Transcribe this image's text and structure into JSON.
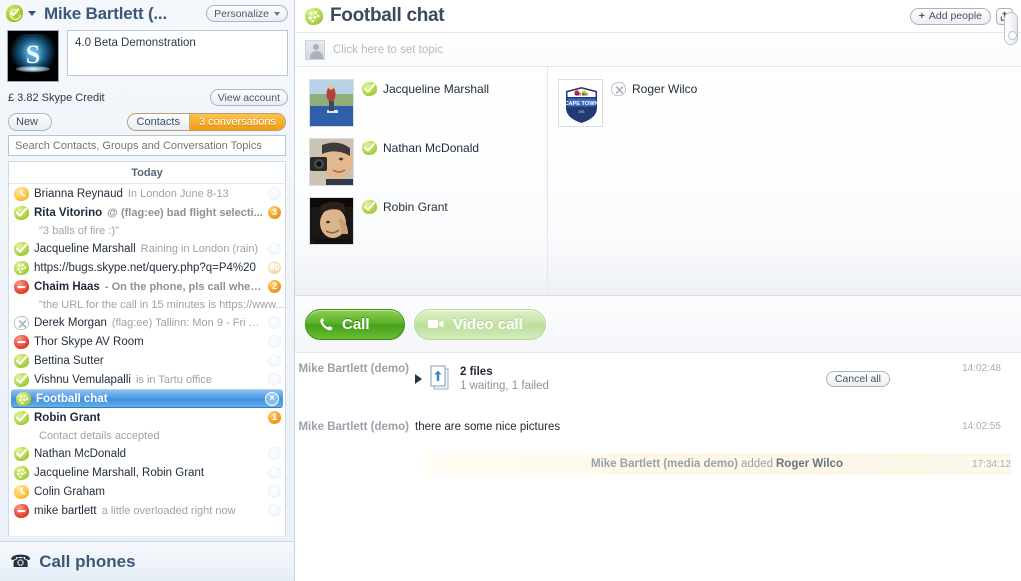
{
  "account": {
    "status_icon": "online-check-icon",
    "name": "Mike Bartlett (...",
    "personalize_label": "Personalize",
    "avatar_letter": "S",
    "mood_message": "4.0 Beta Demonstration",
    "credit": "£ 3.82 Skype Credit",
    "view_account_label": "View account"
  },
  "toolbar": {
    "new_label": "New",
    "tab_contacts": "Contacts",
    "tab_conversations": "3 conversations",
    "search_placeholder": "Search Contacts, Groups and Conversation Topics"
  },
  "list": {
    "day_separator": "Today",
    "rows": [
      {
        "status": "away",
        "name": "Brianna Reynaud",
        "name_bold": false,
        "mood": "In London June 8-13",
        "mood_bold": false,
        "badge": "",
        "badge_style": "ghost",
        "sub": ""
      },
      {
        "status": "online",
        "name": "Rita Vitorino",
        "name_bold": true,
        "mood": "@ (flag:ee) bad flight selecti...",
        "mood_bold": true,
        "badge": "3",
        "badge_style": "solid",
        "sub": "\"3 balls of fire :)\""
      },
      {
        "status": "online",
        "name": "Jacqueline Marshall",
        "name_bold": false,
        "mood": "Raining in London (rain)",
        "mood_bold": false,
        "badge": "",
        "badge_style": "ghost",
        "sub": ""
      },
      {
        "status": "group",
        "name": "https://bugs.skype.net/query.php?q=P4%20",
        "name_bold": false,
        "mood": "",
        "mood_bold": false,
        "badge": "80",
        "badge_style": "dim",
        "sub": ""
      },
      {
        "status": "dnd",
        "name": "Chaim Haas",
        "name_bold": true,
        "mood": "- On the phone, pls call when...",
        "mood_bold": true,
        "badge": "2",
        "badge_style": "solid",
        "sub": "\"the URL for the call in 15 minutes is https://www....\""
      },
      {
        "status": "offline",
        "name": "Derek Morgan",
        "name_bold": false,
        "mood": "(flag:ee) Tallinn: Mon 9 - Fri 13 J...",
        "mood_bold": false,
        "badge": "",
        "badge_style": "ghost",
        "sub": ""
      },
      {
        "status": "dnd",
        "name": "Thor Skype AV Room",
        "name_bold": false,
        "mood": "",
        "mood_bold": false,
        "badge": "",
        "badge_style": "ghost",
        "sub": ""
      },
      {
        "status": "online",
        "name": "Bettina Sutter",
        "name_bold": false,
        "mood": "",
        "mood_bold": false,
        "badge": "",
        "badge_style": "ghost",
        "sub": ""
      },
      {
        "status": "online",
        "name": "Vishnu Vemulapalli",
        "name_bold": false,
        "mood": "is in Tartu office",
        "mood_bold": false,
        "badge": "",
        "badge_style": "ghost",
        "sub": ""
      },
      {
        "status": "group",
        "name": "Football chat",
        "name_bold": true,
        "mood": "",
        "mood_bold": false,
        "badge": "×",
        "badge_style": "close",
        "sub": "",
        "selected": true
      },
      {
        "status": "online",
        "name": "Robin Grant",
        "name_bold": true,
        "mood": "",
        "mood_bold": false,
        "badge": "1",
        "badge_style": "solid",
        "sub": "Contact details accepted"
      },
      {
        "status": "online",
        "name": "Nathan McDonald",
        "name_bold": false,
        "mood": "",
        "mood_bold": false,
        "badge": "",
        "badge_style": "ghost",
        "sub": ""
      },
      {
        "status": "group",
        "name": "Jacqueline Marshall, Robin Grant",
        "name_bold": false,
        "mood": "",
        "mood_bold": false,
        "badge": "",
        "badge_style": "ghost",
        "sub": ""
      },
      {
        "status": "away",
        "name": "Colin Graham",
        "name_bold": false,
        "mood": "",
        "mood_bold": false,
        "badge": "",
        "badge_style": "ghost",
        "sub": ""
      },
      {
        "status": "dnd",
        "name": "mike bartlett",
        "name_bold": false,
        "mood": "a little overloaded right now",
        "mood_bold": false,
        "badge": "",
        "badge_style": "ghost",
        "sub": ""
      }
    ]
  },
  "footer": {
    "call_phones_label": "Call phones",
    "phone_icon": "telephone-icon"
  },
  "chat": {
    "icon": "group-chat-icon",
    "title": "Football chat",
    "add_people_label": "Add people",
    "share_icon": "share-icon",
    "topic_placeholder": "Click here to set topic",
    "participants_col1": [
      {
        "status": "online",
        "name": "Jacqueline Marshall",
        "avatar": "photo-outdoor"
      },
      {
        "status": "online",
        "name": "Nathan McDonald",
        "avatar": "photo-man-camera"
      },
      {
        "status": "online",
        "name": "Robin Grant",
        "avatar": "photo-dark"
      }
    ],
    "participants_col2": [
      {
        "status": "offline",
        "name": "Roger Wilco",
        "avatar": "logo-redbull-cape-town"
      }
    ],
    "call_label": "Call",
    "video_call_label": "Video call",
    "call_icon": "handset-icon",
    "video_icon": "camcorder-icon"
  },
  "transcript": {
    "messages": [
      {
        "kind": "file",
        "from": "Mike Bartlett (demo)",
        "file_title": "2 files",
        "file_status": "1 waiting, 1 failed",
        "cancel_label": "Cancel all",
        "time": "14:02:48"
      },
      {
        "kind": "text",
        "from": "Mike Bartlett (demo)",
        "text": "there are some nice pictures",
        "time": "14:02:55"
      },
      {
        "kind": "system",
        "actor": "Mike Bartlett (media demo)",
        "verb": "added",
        "target": "Roger Wilco",
        "time": "17:34:12"
      }
    ]
  },
  "colors": {
    "accent_blue": "#4e9ae2",
    "orange_badge": "#f2a227",
    "call_green": "#56ae26",
    "title_slate": "#3c5878"
  }
}
